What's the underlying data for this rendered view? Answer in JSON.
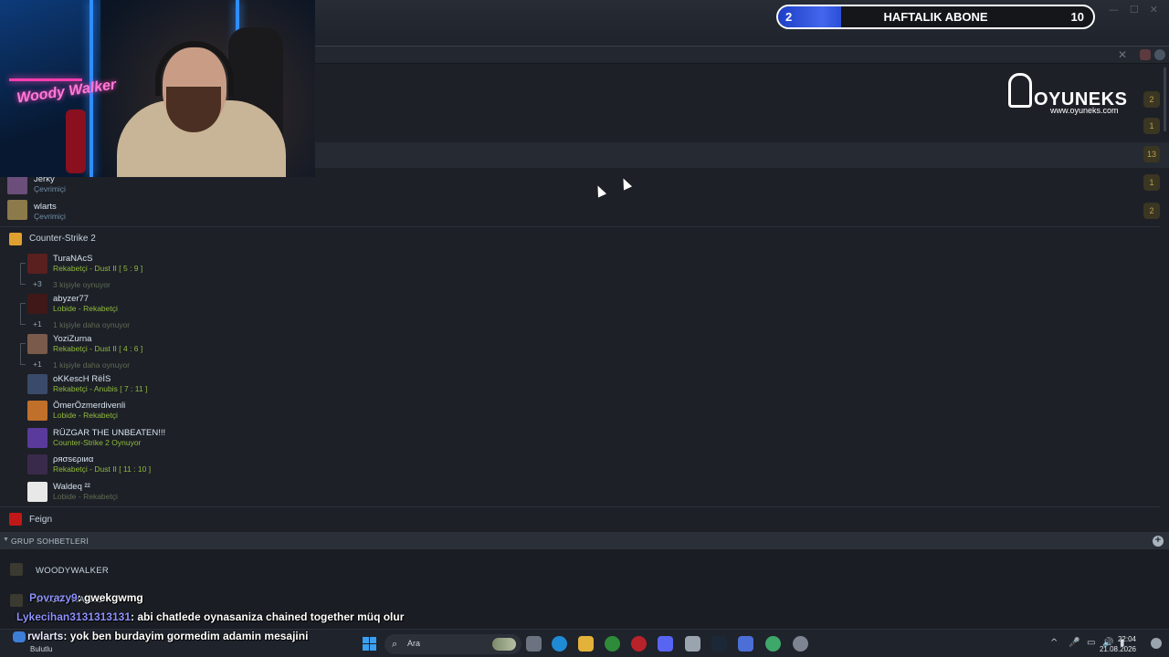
{
  "stream_overlay": {
    "sub_goal": {
      "label": "HAFTALIK ABONE",
      "current": "2",
      "goal": "10",
      "progress": 0.2,
      "bar_color": "#3f63e8"
    },
    "sponsor": {
      "brand": "OYUNEKS",
      "url": "www.oyuneks.com"
    },
    "webcam_caption": "Woody Walker"
  },
  "window_controls": {
    "minimize": "—",
    "maximize": "☐",
    "close": "✕"
  },
  "search_strip": {
    "close_glyph": "✕"
  },
  "count_badges": [
    "2",
    "1",
    "13",
    "1",
    "2"
  ],
  "friends": {
    "online_tail": [
      {
        "name": "Jerky",
        "status": "Çevrimiçi",
        "avatar_color": "#6b4f7a"
      },
      {
        "name": "wlarts",
        "status": "Çevrimiçi",
        "avatar_color": "#8c7a4a"
      }
    ],
    "cs2_group": {
      "title": "Counter-Strike 2",
      "icon_color": "#e0a030",
      "members": [
        {
          "name": "TuraNAcS",
          "status": "Rekabetçi - Dust II [ 5 : 9 ]",
          "extra_count": "+3",
          "extra_text": "3 kişiyle oynuyor",
          "avatar_color": "#5a1f1f"
        },
        {
          "name": "abyzer77",
          "status": "Lobide - Rekabetçi",
          "extra_count": "+1",
          "extra_text": "1 kişiyle daha oynuyor",
          "avatar_color": "#401818"
        },
        {
          "name": "YoziZurna",
          "status": "Rekabetçi - Dust II [ 4 : 6 ]",
          "extra_count": "+1",
          "extra_text": "1 kişiyle daha oynuyor",
          "avatar_color": "#7a5a4a"
        },
        {
          "name": "oKKescH RëİS",
          "status": "Rekabetçi - Anubis [ 7 : 11 ]",
          "avatar_color": "#3a4a6a"
        },
        {
          "name": "ÖmerÖzmerdivenli",
          "status": "Lobide - Rekabetçi",
          "avatar_color": "#c0702a"
        },
        {
          "name": "RÜZGAR THE UNBEATEN!!!",
          "status": "Counter-Strike 2 Oynuyor",
          "avatar_color": "#5a3a9a"
        },
        {
          "name": "ρяσѕєριиα",
          "status": "Rekabetçi - Dust II [ 11 : 10 ]",
          "avatar_color": "#3a2a4a"
        },
        {
          "name": "Waldeq ²²",
          "status": "Lobide - Rekabetçi",
          "avatar_color": "#e8e8e8"
        }
      ]
    },
    "next_group": {
      "title": "Feign",
      "icon_color": "#c01818"
    }
  },
  "group_chats": {
    "header": "GRUP SOHBETLERİ",
    "add_glyph": "+",
    "items": [
      {
        "name": "WOODYWALKER"
      },
      {
        "name": "WOODYWALKER"
      }
    ]
  },
  "chat_overlay": [
    {
      "user": "Povrazy9",
      "message": ": gwekgwmg"
    },
    {
      "user": "Lykecihan3131313131",
      "message": ": abi chatlede oynasaniza chained together müq olur"
    },
    {
      "user": "rwlarts",
      "message": ": yok ben burdayim gormedim adamin mesajini"
    }
  ],
  "taskbar": {
    "weather_label": "Bulutlu",
    "search_placeholder": "Ara",
    "search_glyph": "⌕",
    "tray": {
      "chevron": "^",
      "mic": "🎤",
      "network": "▭",
      "volume": "🔊",
      "battery": "▮"
    },
    "time": "22:04",
    "date": "21.08.2026"
  }
}
